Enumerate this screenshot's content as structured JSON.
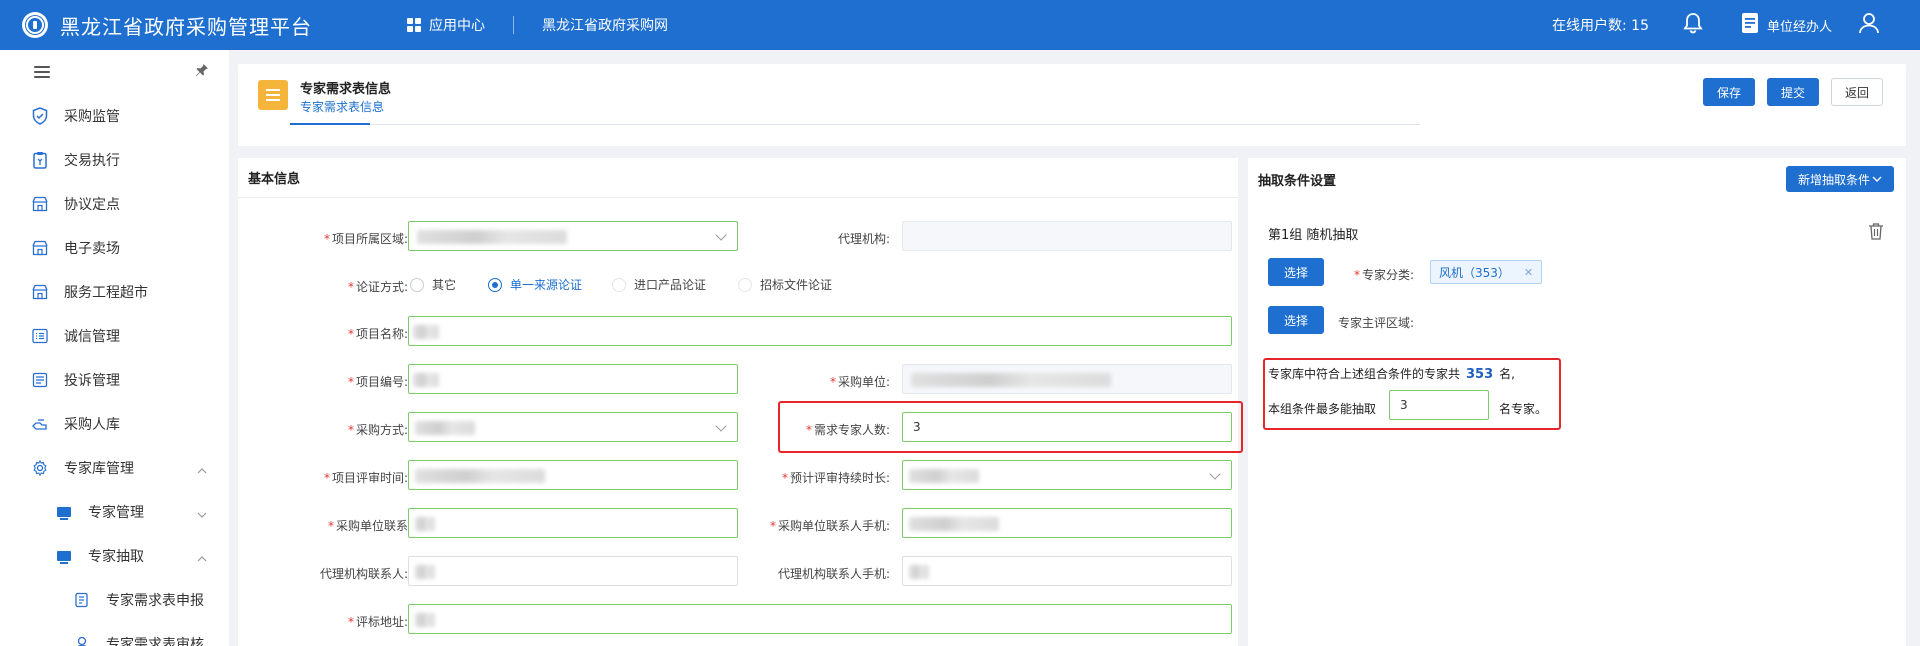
{
  "header": {
    "app_title": "黑龙江省政府采购管理平台",
    "app_center": "应用中心",
    "gov_link": "黑龙江省政府采购网",
    "online_users": "在线用户数: 15",
    "role": "单位经办人"
  },
  "sidebar": {
    "items": [
      {
        "label": "采购监管",
        "icon": "shield-icon"
      },
      {
        "label": "交易执行",
        "icon": "clipboard-icon"
      },
      {
        "label": "协议定点",
        "icon": "store-icon"
      },
      {
        "label": "电子卖场",
        "icon": "store-icon"
      },
      {
        "label": "服务工程超市",
        "icon": "store-icon"
      },
      {
        "label": "诚信管理",
        "icon": "list-icon"
      },
      {
        "label": "投诉管理",
        "icon": "doc-icon"
      },
      {
        "label": "采购人库",
        "icon": "hand-icon"
      },
      {
        "label": "专家库管理",
        "icon": "gear-icon"
      }
    ],
    "sub_items": [
      {
        "label": "专家管理"
      },
      {
        "label": "专家抽取"
      }
    ],
    "sub2_items": [
      {
        "label": "专家需求表申报"
      },
      {
        "label": "专家需求表审核"
      }
    ]
  },
  "title_card": {
    "title": "专家需求表信息",
    "tab": "专家需求表信息",
    "save": "保存",
    "submit": "提交",
    "back": "返回"
  },
  "basic": {
    "head": "基本信息",
    "region_label": "项目所属区域:",
    "agency_label": "代理机构:",
    "method_label": "论证方式:",
    "method_options": [
      "其它",
      "单一来源论证",
      "进口产品论证",
      "招标文件论证"
    ],
    "method_selected": "单一来源论证",
    "name_label": "项目名称:",
    "code_label": "项目编号:",
    "purchaser_label": "采购单位:",
    "proc_method_label": "采购方式:",
    "expert_count_label": "需求专家人数:",
    "expert_count_value": "3",
    "review_time_label": "项目评审时间:",
    "duration_label": "预计评审持续时长:",
    "contact_label": "采购单位联系",
    "contact_phone_label": "采购单位联系人手机:",
    "agency_contact_label": "代理机构联系人:",
    "agency_phone_label": "代理机构联系人手机:",
    "address_label": "评标地址:"
  },
  "extract": {
    "head": "抽取条件设置",
    "add_button": "新增抽取条件",
    "group_title": "第1组   随机抽取",
    "select_button": "选择",
    "category_label": "专家分类:",
    "category_tag": "风机（353）",
    "region_label": "专家主评区域:",
    "summary_prefix": "专家库中符合上述组合条件的专家共",
    "summary_count": "353",
    "summary_suffix": "名,",
    "max_prefix": "本组条件最多能抽取",
    "max_value": "3",
    "max_suffix": "名专家。"
  }
}
